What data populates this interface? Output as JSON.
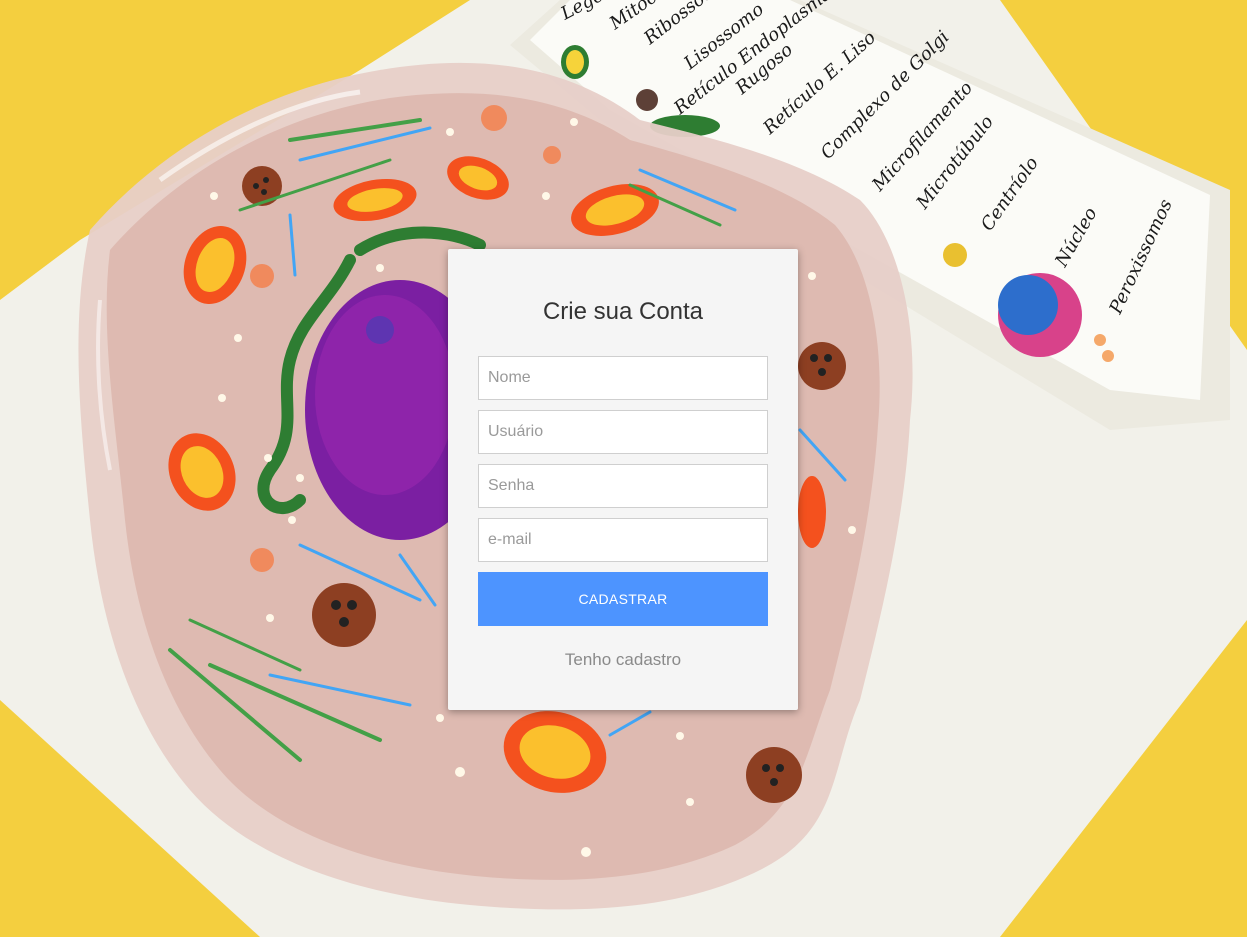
{
  "background": {
    "legend_items": [
      "Lege",
      "Mitoc",
      "Ribossomo",
      "Lisossomo",
      "Retículo Endoplasmático",
      "Rugoso",
      "Retículo E. Liso",
      "Complexo de Golgi",
      "Microfilamento",
      "Microtúbulo",
      "Centríolo",
      "Núcleo",
      "Peroxissomos"
    ]
  },
  "form": {
    "title": "Crie sua Conta",
    "fields": [
      {
        "name": "nome",
        "placeholder": "Nome",
        "value": ""
      },
      {
        "name": "usuario",
        "placeholder": "Usuário",
        "value": ""
      },
      {
        "name": "senha",
        "placeholder": "Senha",
        "value": ""
      },
      {
        "name": "email",
        "placeholder": "e-mail",
        "value": ""
      }
    ],
    "submit_label": "CADASTRAR",
    "login_link": "Tenho cadastro"
  },
  "colors": {
    "accent": "#4d94ff",
    "card_bg": "#f5f5f5",
    "page_bg": "#f3cd3d"
  }
}
